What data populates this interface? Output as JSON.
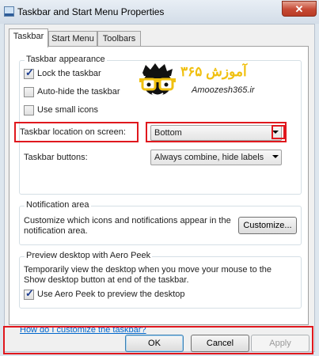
{
  "window": {
    "title": "Taskbar and Start Menu Properties",
    "close_glyph": "✕"
  },
  "tabs": [
    {
      "label": "Taskbar",
      "active": true
    },
    {
      "label": "Start Menu",
      "active": false
    },
    {
      "label": "Toolbars",
      "active": false
    }
  ],
  "taskbar_appearance": {
    "title": "Taskbar appearance",
    "checkboxes": [
      {
        "label": "Lock the taskbar",
        "checked": true
      },
      {
        "label": "Auto-hide the taskbar",
        "checked": false
      },
      {
        "label": "Use small icons",
        "checked": false
      }
    ],
    "location_label": "Taskbar location on screen:",
    "location_value": "Bottom",
    "buttons_label": "Taskbar buttons:",
    "buttons_value": "Always combine, hide labels"
  },
  "notification_area": {
    "title": "Notification area",
    "description_line1": "Customize which icons and notifications appear in the",
    "description_line2": "notification area.",
    "customize_button": "Customize..."
  },
  "aero_peek": {
    "title": "Preview desktop with Aero Peek",
    "description_line1": "Temporarily view the desktop when you move your mouse to the",
    "description_line2": "Show desktop button at end of the taskbar.",
    "checkbox": {
      "label": "Use Aero Peek to preview the desktop",
      "checked": true
    }
  },
  "help_link": "How do I customize the taskbar?",
  "footer": {
    "ok": "OK",
    "cancel": "Cancel",
    "apply": "Apply"
  },
  "watermark": {
    "text_fa": "آموزش ۳۶۵",
    "text_en": "Amoozesh365.ir"
  },
  "colors": {
    "highlight_box": "#e0181e",
    "link": "#0066cc",
    "logo_yellow": "#f0c010"
  }
}
